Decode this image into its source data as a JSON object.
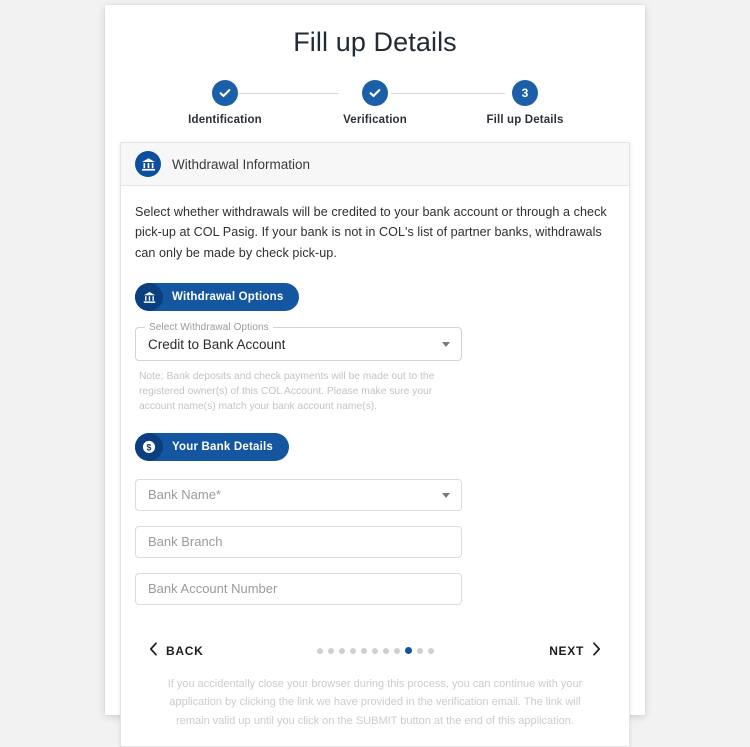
{
  "page": {
    "title": "Fill up Details"
  },
  "stepper": {
    "steps": [
      {
        "label": "Identification",
        "state": "complete",
        "marker": "check"
      },
      {
        "label": "Verification",
        "state": "complete",
        "marker": "check"
      },
      {
        "label": "Fill up Details",
        "state": "current",
        "marker": "3"
      }
    ]
  },
  "panel": {
    "icon": "bank-icon",
    "header_title": "Withdrawal Information",
    "intro": "Select whether withdrawals will be credited to your bank account or through a check pick-up at COL Pasig. If your bank is not in COL's list of partner banks, withdrawals can only be made by check pick-up.",
    "withdrawal_badge": {
      "icon": "bank-icon",
      "label": "Withdrawal Options"
    },
    "withdrawal_select": {
      "label": "Select Withdrawal Options",
      "value": "Credit to Bank Account",
      "caret": "chevron-down-icon"
    },
    "note": "Note: Bank deposits and check payments will be made out to the registered owner(s) of this COL Account. Please make sure your account name(s) match your bank account name(s).",
    "bank_badge": {
      "icon": "dollar-circle-icon",
      "label": "Your Bank Details"
    },
    "fields": [
      {
        "name": "bank-name",
        "placeholder": "Bank Name*",
        "value": "",
        "type": "select"
      },
      {
        "name": "bank-branch",
        "placeholder": "Bank Branch",
        "value": "",
        "type": "text"
      },
      {
        "name": "bank-account-number",
        "placeholder": "Bank Account Number",
        "value": "",
        "type": "text"
      }
    ]
  },
  "footer": {
    "back_label": "BACK",
    "next_label": "NEXT",
    "back_icon": "chevron-left-icon",
    "next_icon": "chevron-right-icon",
    "dots": {
      "total": 11,
      "active_index": 8
    },
    "disclaimer": "If you accidentally close your browser during this process, you can continue with your application by clicking the link we have provided in the verification email. The link will remain valid up until you click on the SUBMIT button at the end of this application."
  },
  "colors": {
    "accent_blue": "#1457a0",
    "dark_blue": "#0b3f80",
    "step_blue": "#1a5fa8",
    "page_bg": "#f2f2f2"
  }
}
